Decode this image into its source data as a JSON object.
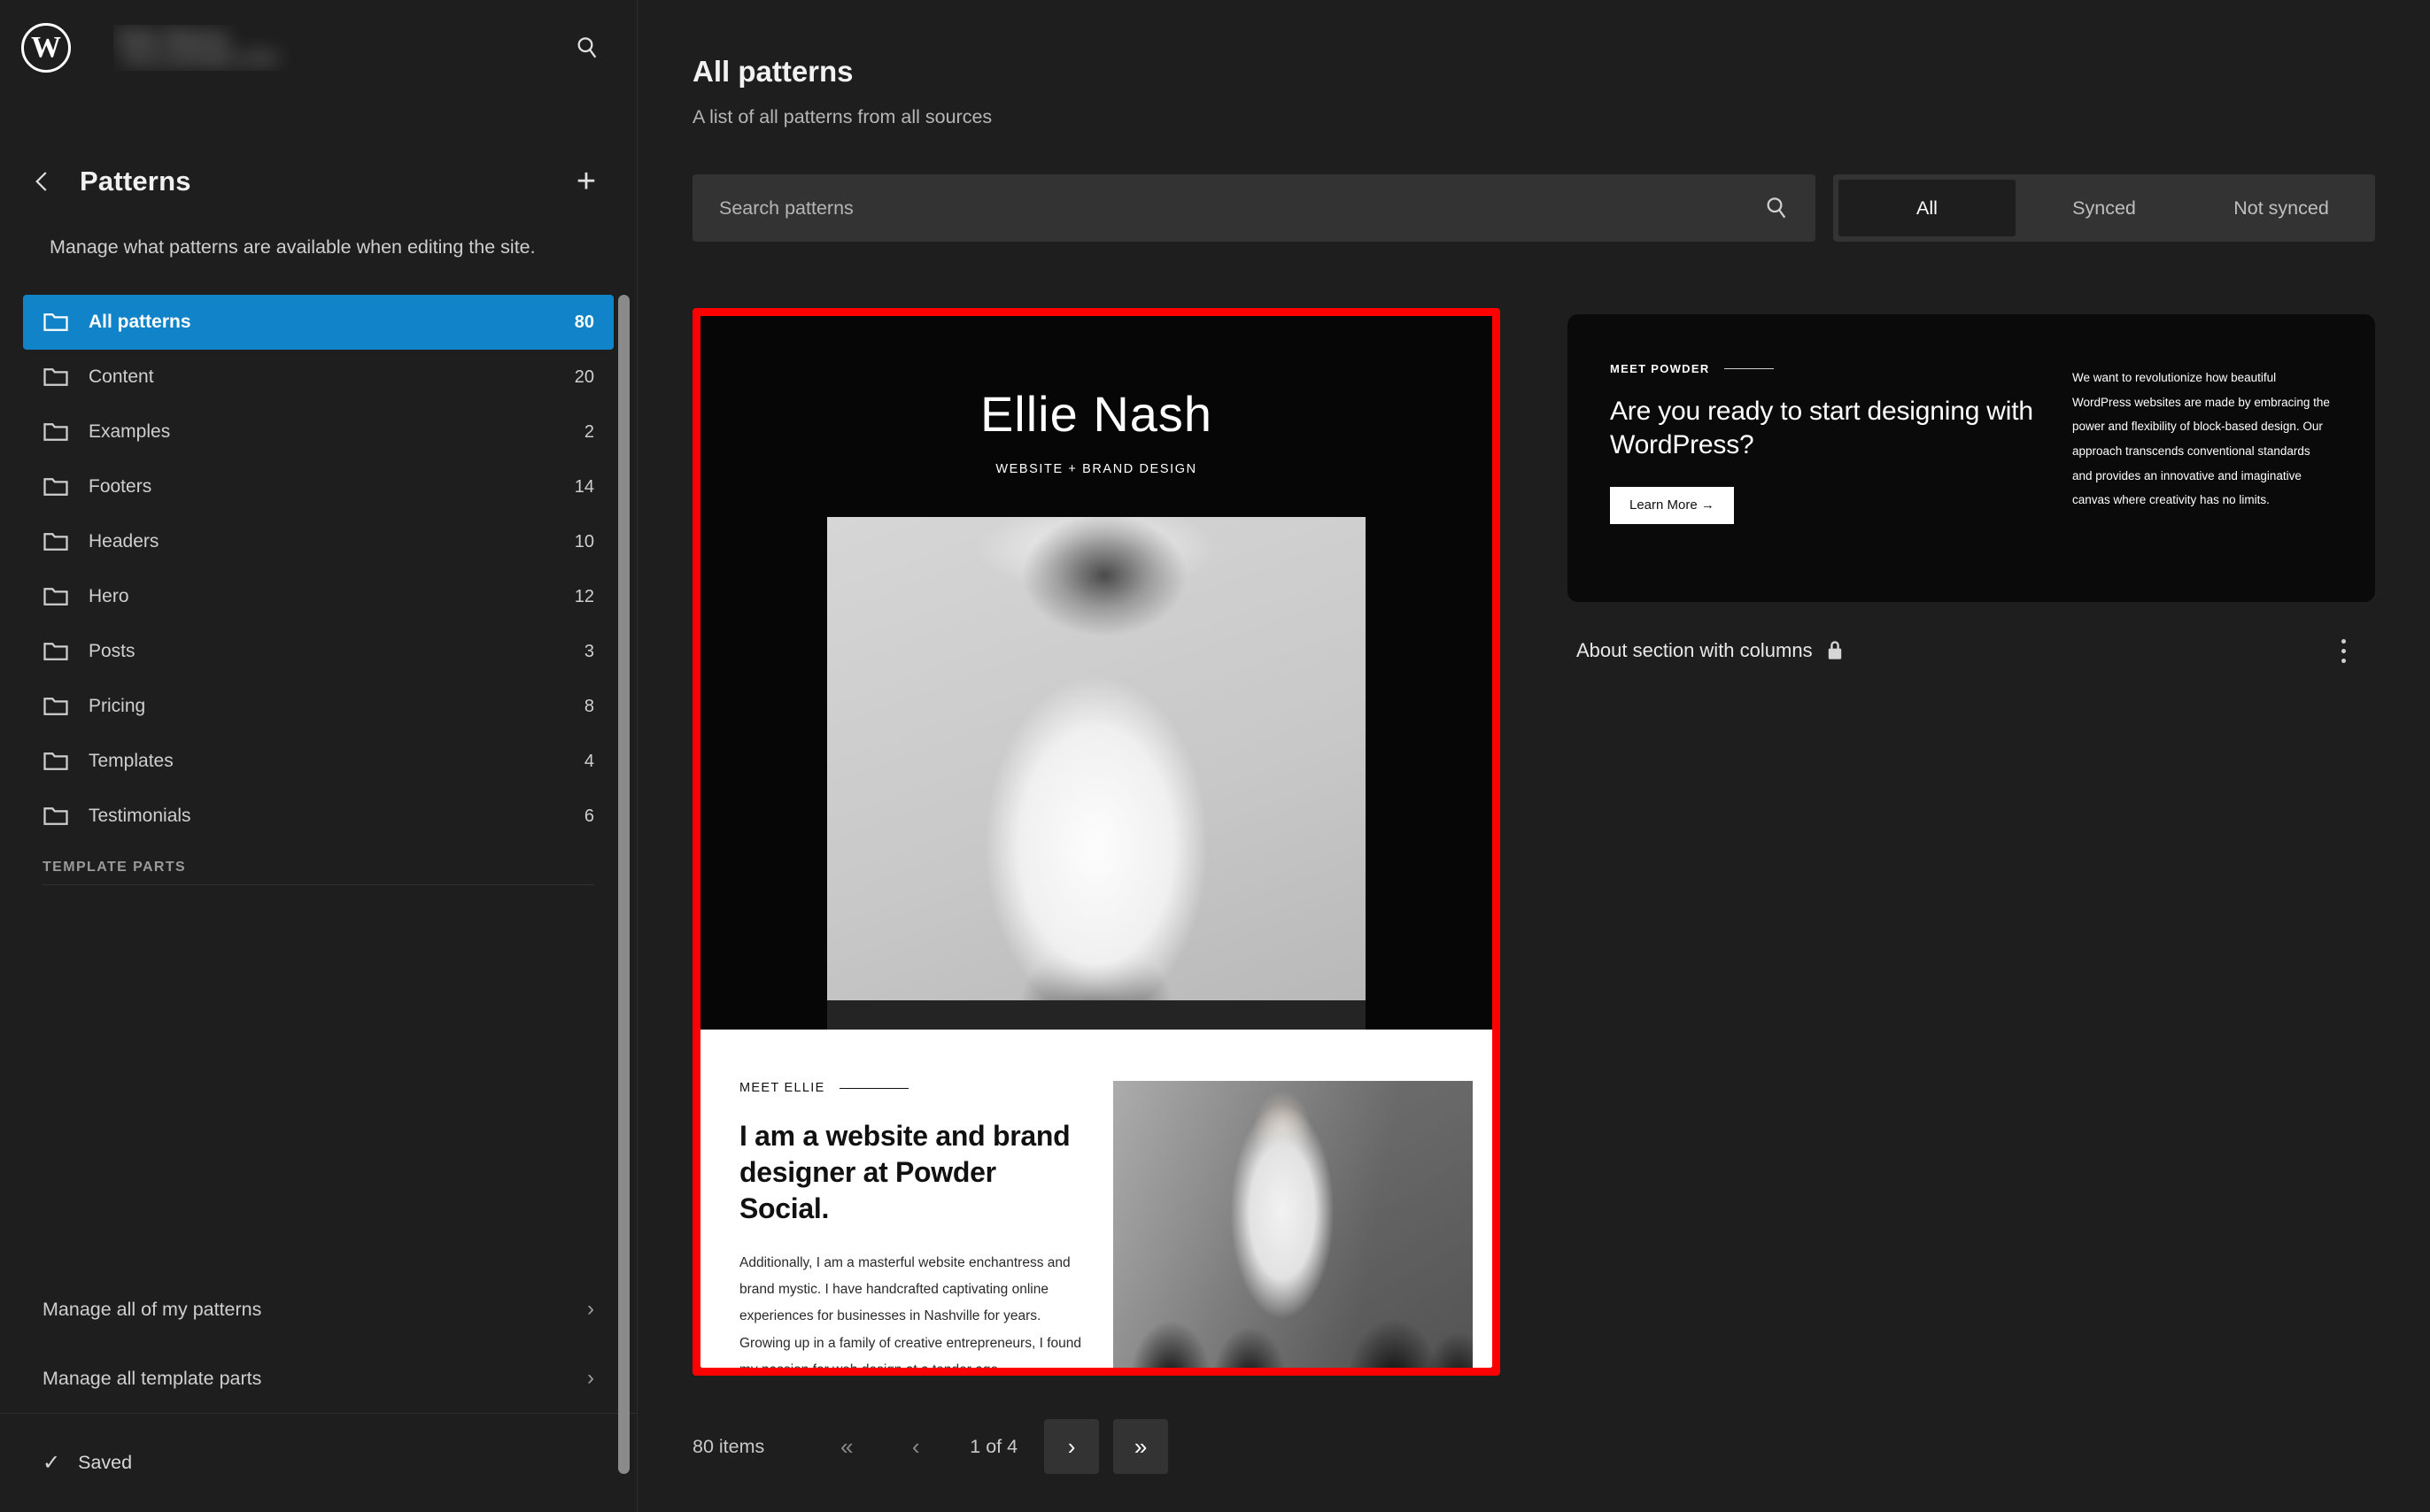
{
  "sidebar": {
    "logo_icon": "wordpress-logo-icon",
    "site_name_line1": "Site Name",
    "site_name_line2": "site.example.com",
    "search_icon": "search-icon",
    "back_icon": "chevron-left-icon",
    "title": "Patterns",
    "add_icon": "plus-icon",
    "add_label": "+",
    "description": "Manage what patterns are available when editing the site.",
    "items": [
      {
        "label": "All patterns",
        "count": "80",
        "icon": "folder-icon",
        "active": true
      },
      {
        "label": "Content",
        "count": "20",
        "icon": "folder-icon",
        "active": false
      },
      {
        "label": "Examples",
        "count": "2",
        "icon": "folder-icon",
        "active": false
      },
      {
        "label": "Footers",
        "count": "14",
        "icon": "folder-icon",
        "active": false
      },
      {
        "label": "Headers",
        "count": "10",
        "icon": "folder-icon",
        "active": false
      },
      {
        "label": "Hero",
        "count": "12",
        "icon": "folder-icon",
        "active": false
      },
      {
        "label": "Posts",
        "count": "3",
        "icon": "folder-icon",
        "active": false
      },
      {
        "label": "Pricing",
        "count": "8",
        "icon": "folder-icon",
        "active": false
      },
      {
        "label": "Templates",
        "count": "4",
        "icon": "folder-icon",
        "active": false
      },
      {
        "label": "Testimonials",
        "count": "6",
        "icon": "folder-icon",
        "active": false
      }
    ],
    "section_heading": "TEMPLATE PARTS",
    "manage_items": [
      {
        "label": "Manage all of my patterns",
        "chevron": "›"
      },
      {
        "label": "Manage all template parts",
        "chevron": "›"
      }
    ],
    "footer": {
      "check_icon": "check-icon",
      "check_glyph": "✓",
      "label": "Saved"
    }
  },
  "main": {
    "title": "All patterns",
    "subtitle": "A list of all patterns from all sources",
    "search": {
      "placeholder": "Search patterns",
      "value": "",
      "icon": "search-icon"
    },
    "filters": [
      {
        "label": "All",
        "active": true
      },
      {
        "label": "Synced",
        "active": false
      },
      {
        "label": "Not synced",
        "active": false
      }
    ],
    "cards": [
      {
        "selected": true,
        "selection_color": "#ff0000",
        "preview": {
          "hero_name": "Ellie Nash",
          "hero_tagline": "WEBSITE + BRAND DESIGN",
          "eyebrow": "MEET ELLIE",
          "heading": "I am a website and brand designer at Powder Social.",
          "body": "Additionally, I am a masterful website enchantress and brand mystic. I have handcrafted captivating online experiences for businesses in Nashville for years. Growing up in a family of creative entrepreneurs, I found my passion for web design at a tender age."
        }
      },
      {
        "selected": false,
        "preview": {
          "eyebrow": "MEET POWDER",
          "heading": "Are you ready to start designing with WordPress?",
          "button_label": "Learn More →",
          "body": "We want to revolutionize how beautiful WordPress websites are made by embracing the power and flexibility of block-based design. Our approach transcends conventional standards and provides an innovative and imaginative canvas where creativity has no limits."
        },
        "title": "About section with columns",
        "lock_icon": "lock-icon",
        "menu_icon": "kebab-menu-icon"
      }
    ],
    "pagination": {
      "items_label": "80 items",
      "first_label": "«",
      "prev_label": "‹",
      "page_label": "1 of 4",
      "next_label": "›",
      "last_label": "»"
    }
  },
  "colors": {
    "accent": "#1183c8",
    "selection": "#ff0000",
    "app_bg": "#1e1e1e",
    "field_bg": "#333333"
  }
}
